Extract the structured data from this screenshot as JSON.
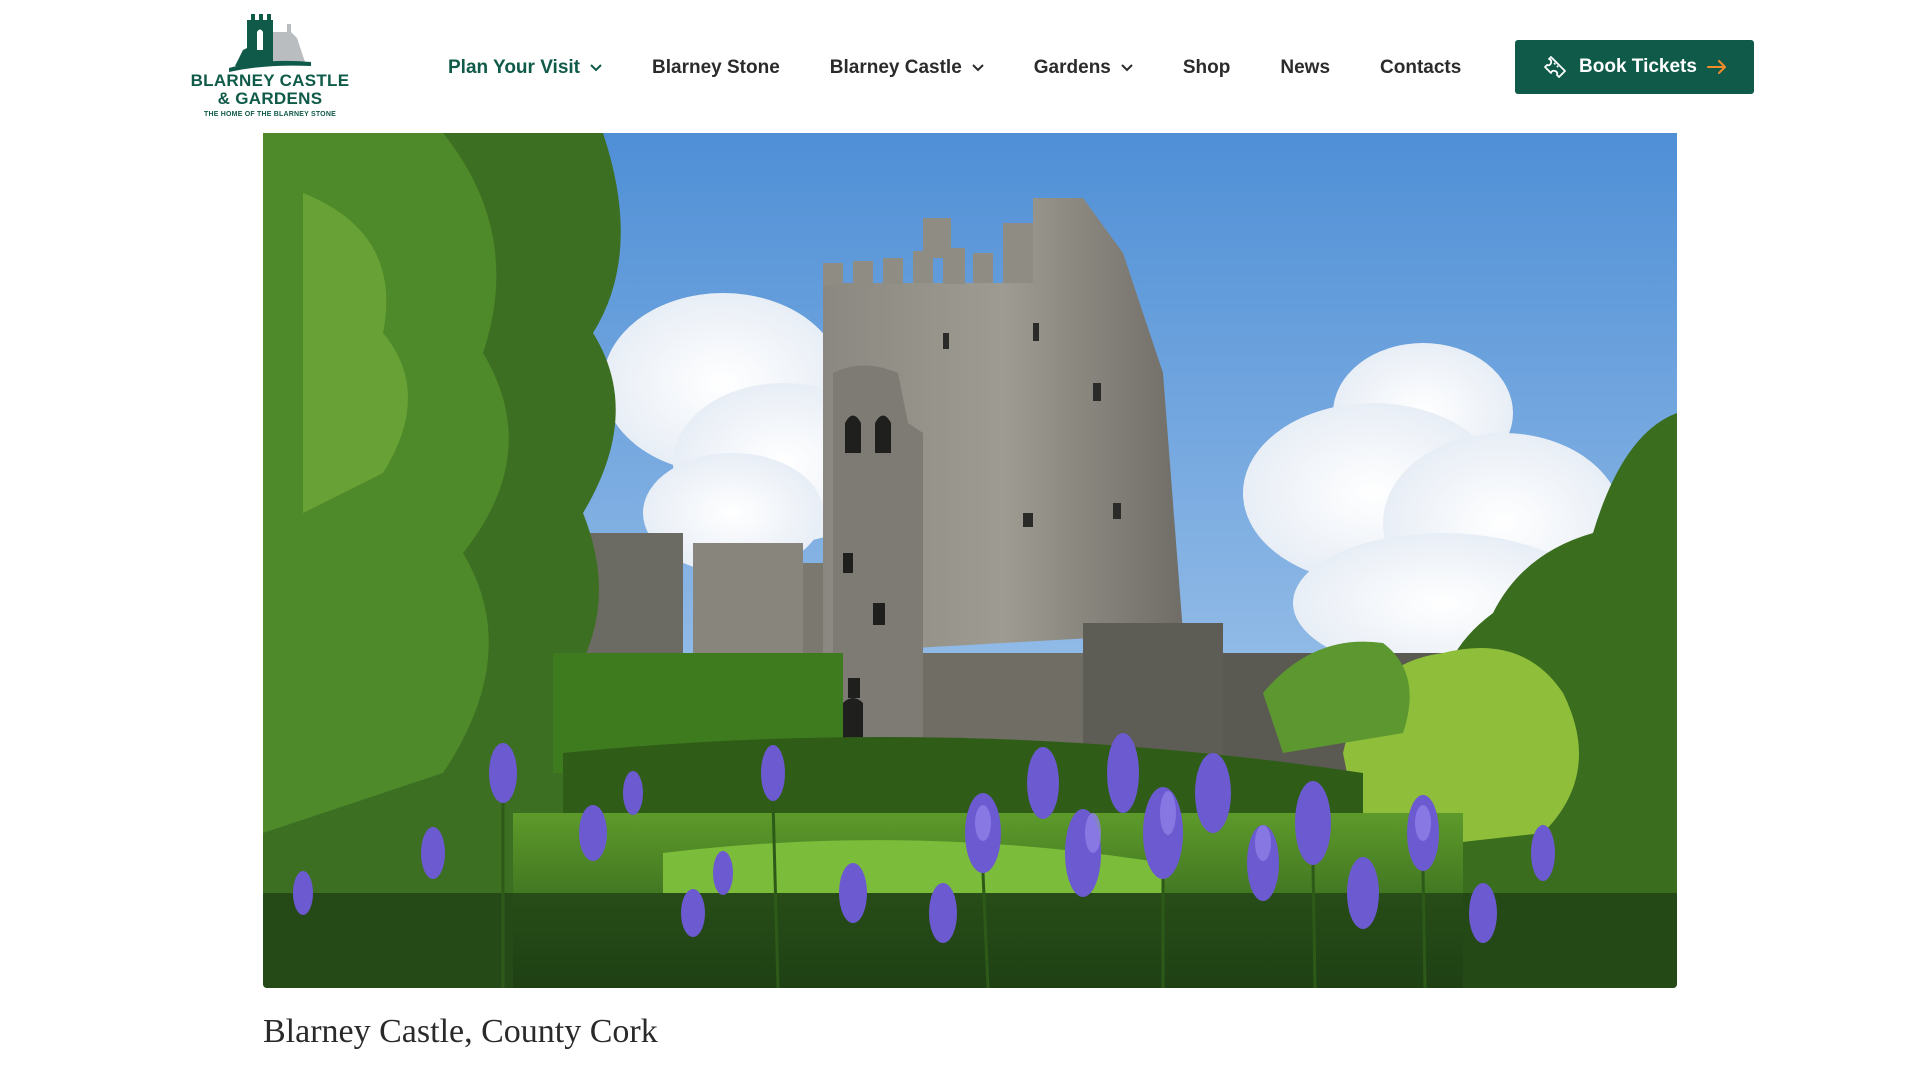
{
  "brand": {
    "name_line1": "BLARNEY CASTLE",
    "name_line2": "& GARDENS",
    "tagline": "THE HOME OF THE BLARNEY STONE",
    "color": "#0f5a48"
  },
  "nav": {
    "items": [
      {
        "label": "Plan Your Visit",
        "dropdown": true,
        "active": true
      },
      {
        "label": "Blarney Stone",
        "dropdown": false,
        "active": false
      },
      {
        "label": "Blarney Castle",
        "dropdown": true,
        "active": false
      },
      {
        "label": "Gardens",
        "dropdown": true,
        "active": false
      },
      {
        "label": "Shop",
        "dropdown": false,
        "active": false
      },
      {
        "label": "News",
        "dropdown": false,
        "active": false
      },
      {
        "label": "Contacts",
        "dropdown": false,
        "active": false
      }
    ]
  },
  "cta": {
    "label": "Book Tickets",
    "icon_left": "ticket-icon",
    "icon_right": "arrow-right-icon",
    "accent": "#f28c28"
  },
  "hero": {
    "caption": "Blarney Castle, County Cork"
  }
}
